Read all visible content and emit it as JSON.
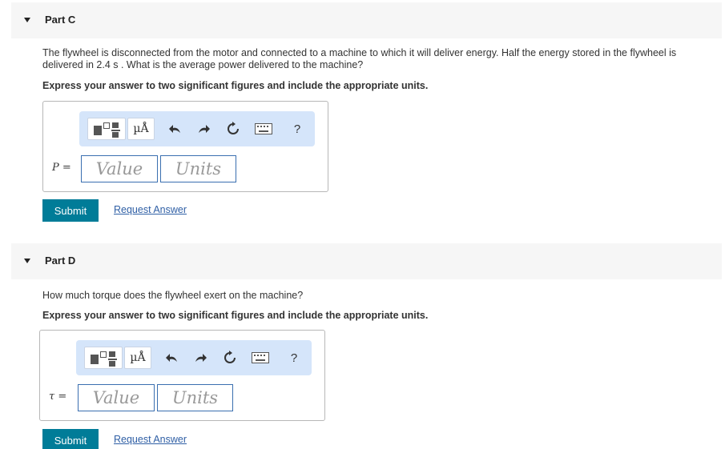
{
  "part_c": {
    "title": "Part C",
    "prompt": "The flywheel is disconnected from the motor and connected to a machine to which it will deliver energy. Half the energy stored in the flywheel is delivered in 2.4 s . What is the average power delivered to the machine?",
    "instruction": "Express your answer to two significant figures and include the appropriate units.",
    "variable_label": "P =",
    "value_placeholder": "Value",
    "units_placeholder": "Units",
    "toolbar": {
      "units_label": "µÅ",
      "help_label": "?"
    },
    "submit_label": "Submit",
    "request_answer_label": "Request Answer"
  },
  "part_d": {
    "title": "Part D",
    "prompt": "How much torque does the flywheel exert on the machine?",
    "instruction": "Express your answer to two significant figures and include the appropriate units.",
    "variable_label": "τ =",
    "value_placeholder": "Value",
    "units_placeholder": "Units",
    "toolbar": {
      "units_label": "µÅ",
      "help_label": "?"
    },
    "submit_label": "Submit",
    "request_answer_label": "Request Answer"
  }
}
